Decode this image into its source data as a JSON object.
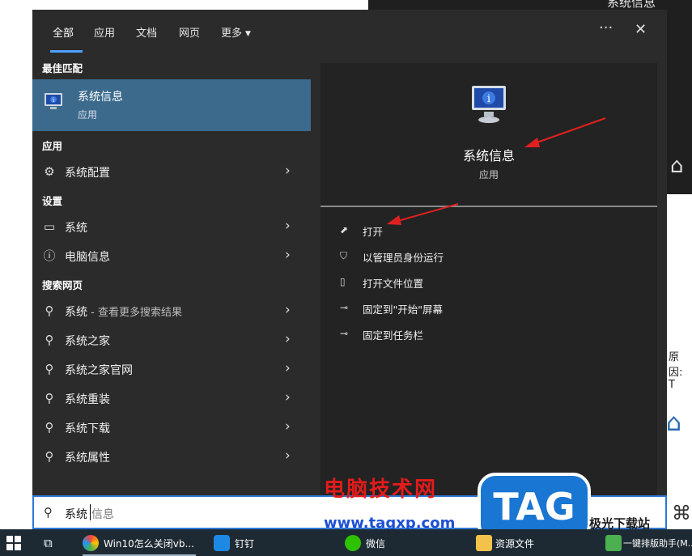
{
  "background": {
    "window_title": "系统信息",
    "partial_text": "原因: T"
  },
  "tabs": [
    {
      "label": "全部",
      "active": true
    },
    {
      "label": "应用"
    },
    {
      "label": "文档"
    },
    {
      "label": "网页"
    },
    {
      "label": "更多"
    }
  ],
  "topbar": {
    "more_options": "···",
    "close": "✕"
  },
  "left": {
    "best_match_header": "最佳匹配",
    "best_match": {
      "title": "系统信息",
      "subtitle": "应用"
    },
    "apps_header": "应用",
    "apps": [
      {
        "label": "系统配置"
      }
    ],
    "settings_header": "设置",
    "settings": [
      {
        "label": "系统"
      },
      {
        "label": "电脑信息"
      }
    ],
    "web_header": "搜索网页",
    "web": [
      {
        "label": "系统",
        "muted": " - 查看更多搜索结果"
      },
      {
        "label": "系统之家"
      },
      {
        "label": "系统之家官网"
      },
      {
        "label": "系统重装"
      },
      {
        "label": "系统下载"
      },
      {
        "label": "系统属性"
      }
    ]
  },
  "right": {
    "app_title": "系统信息",
    "app_subtitle": "应用",
    "actions": [
      {
        "label": "打开",
        "icon": "open-icon"
      },
      {
        "label": "以管理员身份运行",
        "icon": "shield-icon"
      },
      {
        "label": "打开文件位置",
        "icon": "file-location-icon"
      },
      {
        "label": "固定到\"开始\"屏幕",
        "icon": "pin-icon"
      },
      {
        "label": "固定到任务栏",
        "icon": "pin-icon"
      }
    ]
  },
  "search": {
    "typed": "系统",
    "suggestion": "信息"
  },
  "taskbar": {
    "items": [
      {
        "label": "Win10怎么关闭vb..."
      },
      {
        "label": "钉钉"
      },
      {
        "label": "微信"
      },
      {
        "label": "资源文件"
      },
      {
        "label": "一键排版助手(M..."
      }
    ]
  },
  "watermark": {
    "site_name": "电脑技术网",
    "url": "www.tagxp.com",
    "tag": "TAG",
    "brand": "极光下载站"
  },
  "colors": {
    "panel_bg": "#2b2b2b",
    "highlight": "#3b6a8c",
    "accent": "#4ea0ff",
    "arrow": "#e02020"
  }
}
